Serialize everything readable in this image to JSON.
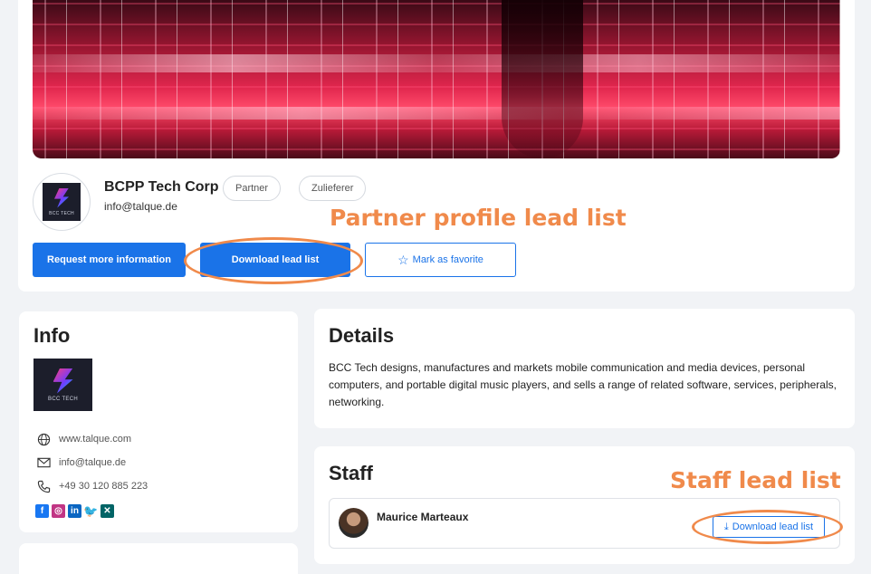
{
  "header": {
    "company_name": "BCPP Tech Corp",
    "company_email": "info@talque.de",
    "logo_text": "BCC TECH",
    "tags": [
      "Partner",
      "Zulieferer"
    ],
    "buttons": {
      "request_info": "Request more information",
      "download_lead_list": "Download lead list",
      "mark_favorite": "Mark as favorite"
    }
  },
  "annotations": {
    "partner_label": "Partner profile lead list",
    "staff_label": "Staff lead list"
  },
  "info": {
    "title": "Info",
    "logo_text": "BCC TECH",
    "website": "www.talque.com",
    "email": "info@talque.de",
    "phone": "+49 30 120 885 223",
    "social": [
      {
        "name": "facebook-icon",
        "glyph": "f"
      },
      {
        "name": "instagram-icon",
        "glyph": "◎"
      },
      {
        "name": "linkedin-icon",
        "glyph": "in"
      },
      {
        "name": "twitter-icon",
        "glyph": "🐦"
      },
      {
        "name": "xing-icon",
        "glyph": "✕"
      }
    ]
  },
  "details": {
    "title": "Details",
    "text": "BCC Tech designs, manufactures and markets mobile communication and media devices, personal computers, and portable digital music players, and sells a range of related software, services, peripherals, networking."
  },
  "staff": {
    "title": "Staff",
    "members": [
      {
        "name": "Maurice Marteaux",
        "download_label": "Download lead list"
      }
    ]
  },
  "colors": {
    "primary": "#1a73e8",
    "annotation": "#f08a4b",
    "background": "#f1f3f6"
  }
}
